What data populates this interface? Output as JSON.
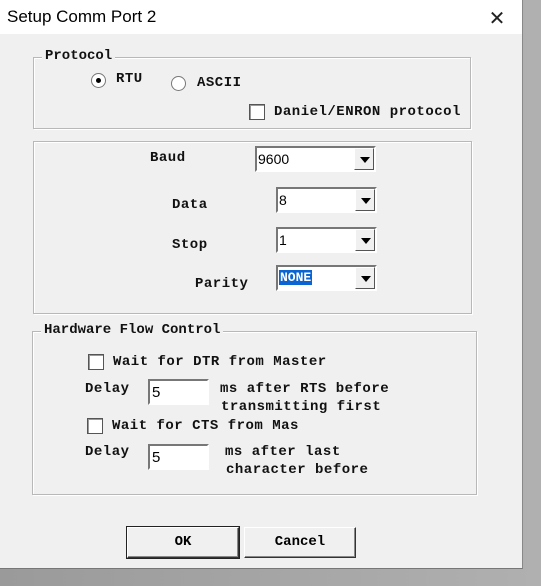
{
  "window": {
    "title": "Setup Comm Port 2",
    "close_icon": "close-icon"
  },
  "protocol": {
    "legend": "Protocol",
    "rtu_label": "RTU",
    "rtu_selected": true,
    "ascii_label": "ASCII",
    "ascii_selected": false,
    "daniel_label": "Daniel/ENRON protocol",
    "daniel_checked": false
  },
  "serial": {
    "baud": {
      "label": "Baud",
      "value": "9600"
    },
    "data": {
      "label": "Data",
      "value": "8"
    },
    "stop": {
      "label": "Stop",
      "value": "1"
    },
    "parity": {
      "label": "Parity",
      "value": "NONE"
    }
  },
  "flow": {
    "legend": "Hardware Flow Control",
    "dtr_label": "Wait for DTR from Master",
    "dtr_checked": false,
    "delay1_label": "Delay",
    "delay1_value": "5",
    "delay1_desc1": "ms after RTS before",
    "delay1_desc2": "transmitting first",
    "cts_label": "Wait for CTS from Mas",
    "cts_checked": false,
    "delay2_label": "Delay",
    "delay2_value": "5",
    "delay2_desc1": "ms after last",
    "delay2_desc2": "character before"
  },
  "buttons": {
    "ok": "OK",
    "cancel": "Cancel"
  },
  "colors": {
    "selection": "#0a64d2",
    "dialog_bg": "#f0f0f0"
  }
}
